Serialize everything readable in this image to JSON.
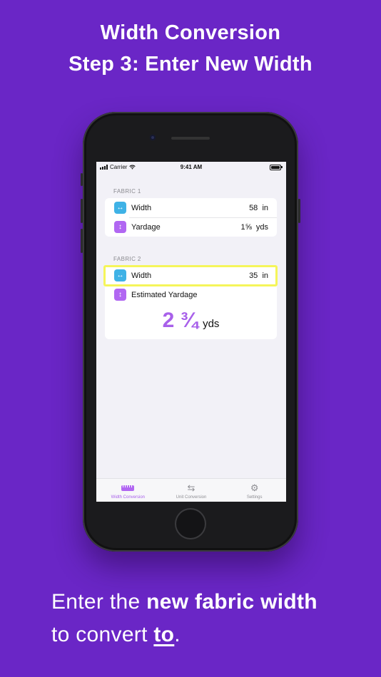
{
  "heading": {
    "line1": "Width Conversion",
    "line2": "Step 3: Enter New Width"
  },
  "status_bar": {
    "carrier": "Carrier",
    "time": "9:41 AM"
  },
  "fabric1": {
    "section_label": "FABRIC 1",
    "width_label": "Width",
    "width_value": "58",
    "width_unit": "in",
    "yardage_label": "Yardage",
    "yardage_value": "1⅝",
    "yardage_unit": "yds"
  },
  "fabric2": {
    "section_label": "FABRIC 2",
    "width_label": "Width",
    "width_value": "35",
    "width_unit": "in",
    "estimated_label": "Estimated Yardage",
    "estimated_value": "2 ¾",
    "estimated_unit": "yds"
  },
  "tabs": [
    {
      "label": "Width Conversion",
      "icon": "ruler-icon",
      "active": true
    },
    {
      "label": "Unit Conversion",
      "icon": "swap-arrows-icon",
      "active": false
    },
    {
      "label": "Settings",
      "icon": "gear-icon",
      "active": false
    }
  ],
  "footer": {
    "line1_prefix": "Enter the ",
    "line1_bold": "new fabric width",
    "line2_prefix": "to convert ",
    "line2_bold": "to",
    "line2_suffix": "."
  },
  "colors": {
    "background": "#6a26c6",
    "accent_purple": "#a860ea",
    "icon_blue": "#3fb2e6",
    "highlight_yellow": "#f5f55a"
  }
}
